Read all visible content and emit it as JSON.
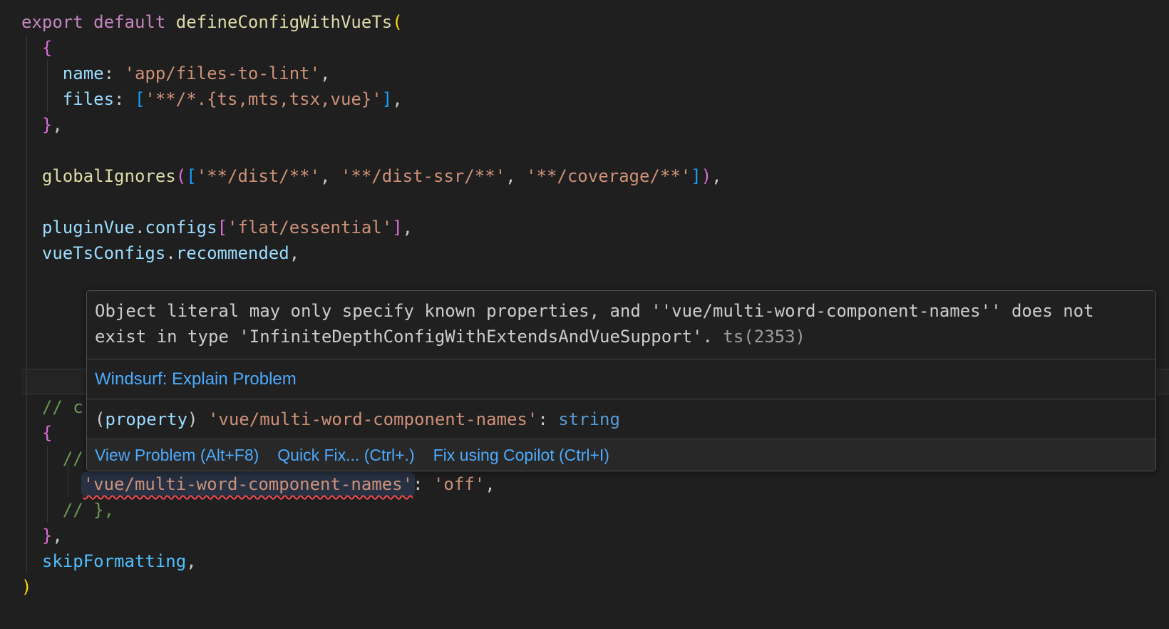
{
  "editor": {
    "background": "#1f1f1f",
    "colors": {
      "kw": "#C586C0",
      "fn": "#DCDCAA",
      "prop": "#9CDCFE",
      "const": "#4FC1FF",
      "str": "#CE9178",
      "com": "#6A9955",
      "pun": "#CCCCCC",
      "b1": "#FFD700",
      "b2": "#DA70D6",
      "b3": "#179FFF",
      "type": "#569CD6"
    },
    "decoration_colors": {
      "squiggle": "#F14C4C",
      "word_highlight": "#273142",
      "current_line_border": "#383838"
    },
    "lines": [
      {
        "tokens": [
          {
            "t": "export default ",
            "c": "kw"
          },
          {
            "t": "defineConfigWithVueTs",
            "c": "fn"
          },
          {
            "t": "(",
            "c": "b1"
          }
        ]
      },
      {
        "tokens": [
          {
            "t": "  ",
            "c": "pun"
          },
          {
            "t": "{",
            "c": "b2"
          }
        ]
      },
      {
        "tokens": [
          {
            "t": "    ",
            "c": "pun"
          },
          {
            "t": "name",
            "c": "prop"
          },
          {
            "t": ": ",
            "c": "pun"
          },
          {
            "t": "'app/files-to-lint'",
            "c": "str"
          },
          {
            "t": ",",
            "c": "pun"
          }
        ]
      },
      {
        "tokens": [
          {
            "t": "    ",
            "c": "pun"
          },
          {
            "t": "files",
            "c": "prop"
          },
          {
            "t": ": ",
            "c": "pun"
          },
          {
            "t": "[",
            "c": "b3"
          },
          {
            "t": "'**/*.{ts,mts,tsx,vue}'",
            "c": "str"
          },
          {
            "t": "]",
            "c": "b3"
          },
          {
            "t": ",",
            "c": "pun"
          }
        ]
      },
      {
        "tokens": [
          {
            "t": "  ",
            "c": "pun"
          },
          {
            "t": "}",
            "c": "b2"
          },
          {
            "t": ",",
            "c": "pun"
          }
        ]
      },
      {
        "tokens": []
      },
      {
        "tokens": [
          {
            "t": "  ",
            "c": "pun"
          },
          {
            "t": "globalIgnores",
            "c": "fn"
          },
          {
            "t": "(",
            "c": "b2"
          },
          {
            "t": "[",
            "c": "b3"
          },
          {
            "t": "'**/dist/**'",
            "c": "str"
          },
          {
            "t": ", ",
            "c": "pun"
          },
          {
            "t": "'**/dist-ssr/**'",
            "c": "str"
          },
          {
            "t": ", ",
            "c": "pun"
          },
          {
            "t": "'**/coverage/**'",
            "c": "str"
          },
          {
            "t": "]",
            "c": "b3"
          },
          {
            "t": ")",
            "c": "b2"
          },
          {
            "t": ",",
            "c": "pun"
          }
        ]
      },
      {
        "tokens": []
      },
      {
        "tokens": [
          {
            "t": "  ",
            "c": "pun"
          },
          {
            "t": "pluginVue",
            "c": "prop"
          },
          {
            "t": ".",
            "c": "pun"
          },
          {
            "t": "configs",
            "c": "prop"
          },
          {
            "t": "[",
            "c": "b2"
          },
          {
            "t": "'flat/essential'",
            "c": "str"
          },
          {
            "t": "]",
            "c": "b2"
          },
          {
            "t": ",",
            "c": "pun"
          }
        ]
      },
      {
        "tokens": [
          {
            "t": "  ",
            "c": "pun"
          },
          {
            "t": "vueTsConfigs",
            "c": "prop"
          },
          {
            "t": ".",
            "c": "pun"
          },
          {
            "t": "recommended",
            "c": "prop"
          },
          {
            "t": ",",
            "c": "pun"
          }
        ]
      },
      {
        "tokens": []
      },
      {
        "tokens": []
      },
      {
        "tokens": []
      },
      {
        "tokens": []
      },
      {
        "tokens": [],
        "current": true
      },
      {
        "tokens": [
          {
            "t": "  // c",
            "c": "com"
          }
        ]
      },
      {
        "tokens": [
          {
            "t": "  ",
            "c": "pun"
          },
          {
            "t": "{",
            "c": "b2"
          }
        ]
      },
      {
        "tokens": [
          {
            "t": "    //",
            "c": "com"
          }
        ]
      },
      {
        "tokens": [
          {
            "t": "      ",
            "c": "pun"
          },
          {
            "t": "'vue/multi-word-component-names'",
            "c": "str",
            "hl": true,
            "squig": true,
            "error": true
          },
          {
            "t": ": ",
            "c": "pun"
          },
          {
            "t": "'off'",
            "c": "str"
          },
          {
            "t": ",",
            "c": "pun"
          }
        ]
      },
      {
        "tokens": [
          {
            "t": "    // },",
            "c": "com"
          }
        ]
      },
      {
        "tokens": [
          {
            "t": "  ",
            "c": "pun"
          },
          {
            "t": "}",
            "c": "b2"
          },
          {
            "t": ",",
            "c": "pun"
          }
        ]
      },
      {
        "tokens": [
          {
            "t": "  ",
            "c": "pun"
          },
          {
            "t": "skipFormatting",
            "c": "const"
          },
          {
            "t": ",",
            "c": "pun"
          }
        ]
      },
      {
        "tokens": [
          {
            "t": ")",
            "c": "b1"
          }
        ]
      }
    ]
  },
  "hover": {
    "message": "Object literal may only specify known properties, and ''vue/multi-word-component-names'' does not exist in type 'InfiniteDepthConfigWithExtendsAndVueSupport'. ",
    "source": "ts(2353)",
    "windsurf_action": "Windsurf: Explain Problem",
    "property_tokens": [
      {
        "t": "(",
        "c": "pun"
      },
      {
        "t": "property",
        "c": "prop"
      },
      {
        "t": ") ",
        "c": "pun"
      },
      {
        "t": "'vue/multi-word-component-names'",
        "c": "str"
      },
      {
        "t": ": ",
        "c": "pun"
      },
      {
        "t": "string",
        "c": "type"
      }
    ],
    "actions": [
      {
        "label": "View Problem (Alt+F8)"
      },
      {
        "label": "Quick Fix... (Ctrl+.)"
      },
      {
        "label": "Fix using Copilot (Ctrl+I)"
      }
    ],
    "link_color": "#4daafc"
  }
}
